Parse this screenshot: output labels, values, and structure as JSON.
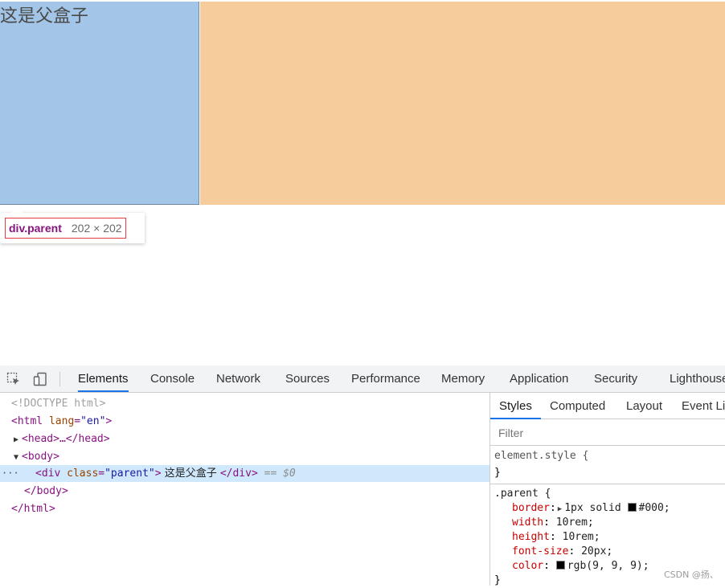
{
  "preview": {
    "parent_text": "这是父盒子",
    "tooltip_selector": "div.parent",
    "tooltip_size": "202 × 202"
  },
  "devtools": {
    "tabs": [
      "Elements",
      "Console",
      "Network",
      "Sources",
      "Performance",
      "Memory",
      "Application",
      "Security",
      "Lighthouse"
    ],
    "active_tab": "Elements",
    "elements": {
      "doctype": "<!DOCTYPE html>",
      "html_open_tag": "<html",
      "html_lang_attr": "lang",
      "html_lang_val": "\"en\"",
      "html_open_end": ">",
      "head_collapsed": "<head>…</head>",
      "body_open": "<body>",
      "div_open_tag": "<div",
      "div_class_attr": "class",
      "div_class_val": "\"parent\"",
      "div_open_end": ">",
      "div_text": " 这是父盒子 ",
      "div_close": "</div>",
      "selected_marker": "== $0",
      "body_close": "</body>",
      "html_close": "</html>",
      "gutter_dots": "···"
    },
    "styles_panel": {
      "tabs": [
        "Styles",
        "Computed",
        "Layout",
        "Event Lis"
      ],
      "active_tab": "Styles",
      "filter_placeholder": "Filter",
      "element_style_selector": "element.style {",
      "element_style_close": "}",
      "parent_rule_selector": ".parent {",
      "declarations": [
        {
          "prop": "border",
          "value": "1px solid ",
          "color": "#000",
          "color_text": "#000;"
        },
        {
          "prop": "width",
          "value": "10rem;"
        },
        {
          "prop": "height",
          "value": "10rem;"
        },
        {
          "prop": "font-size",
          "value": "20px;"
        },
        {
          "prop": "color",
          "value": "",
          "color": "#090909",
          "color_text": "rgb(9, 9, 9);"
        }
      ],
      "rule_close": "}"
    }
  },
  "watermark": "CSDN @扬、"
}
